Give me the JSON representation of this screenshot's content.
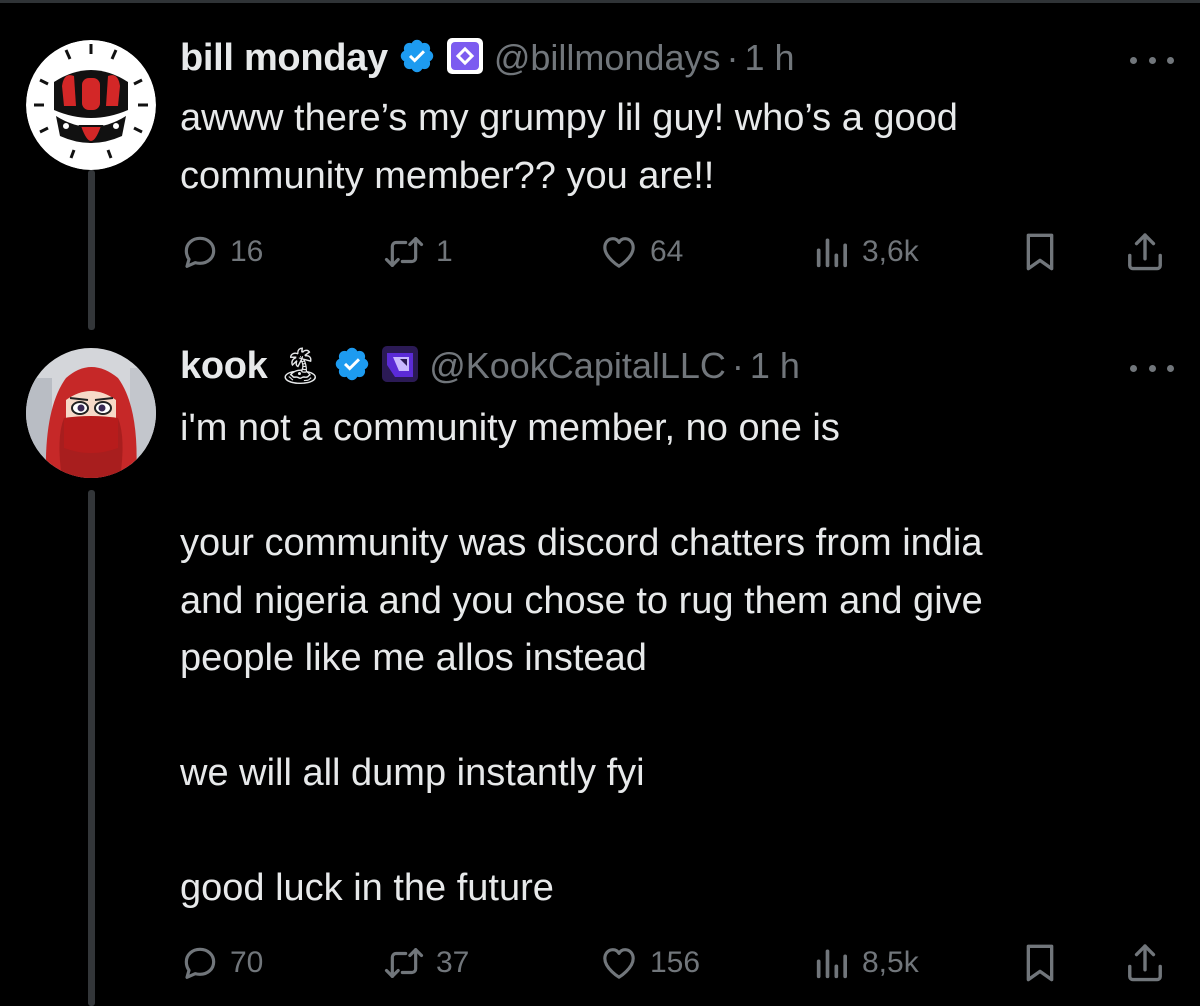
{
  "tweets": [
    {
      "name": "bill monday",
      "handle": "@billmondays",
      "separator": "·",
      "time": "1 h",
      "lines": [
        "awww there’s my grumpy lil guy! who’s a good",
        "community member?? you are!!"
      ],
      "stats": {
        "replies": "16",
        "reposts": "1",
        "likes": "64",
        "views": "3,6k"
      },
      "affiliate_badge_color": "#7c5cf0"
    },
    {
      "name": "kook",
      "emoji": "🏝",
      "handle": "@KookCapitalLLC",
      "separator": "·",
      "time": "1 h",
      "lines": [
        "i'm not a community member, no one is",
        "",
        "your community was discord chatters from india",
        "and nigeria and you chose to rug them and give",
        "people like me allos instead",
        "",
        "we will all dump instantly fyi",
        "",
        "good luck in the future"
      ],
      "stats": {
        "replies": "70",
        "reposts": "37",
        "likes": "156",
        "views": "8,5k"
      },
      "affiliate_badge_color": "#5b2bd6"
    }
  ],
  "colors": {
    "background": "#000000",
    "text": "#e7e9ea",
    "muted": "#71767b",
    "verified": "#1d9bf0",
    "thread_line": "#333639"
  },
  "icons": [
    "reply-icon",
    "repost-icon",
    "like-icon",
    "views-icon",
    "bookmark-icon",
    "share-icon",
    "verified-icon",
    "more-icon"
  ]
}
